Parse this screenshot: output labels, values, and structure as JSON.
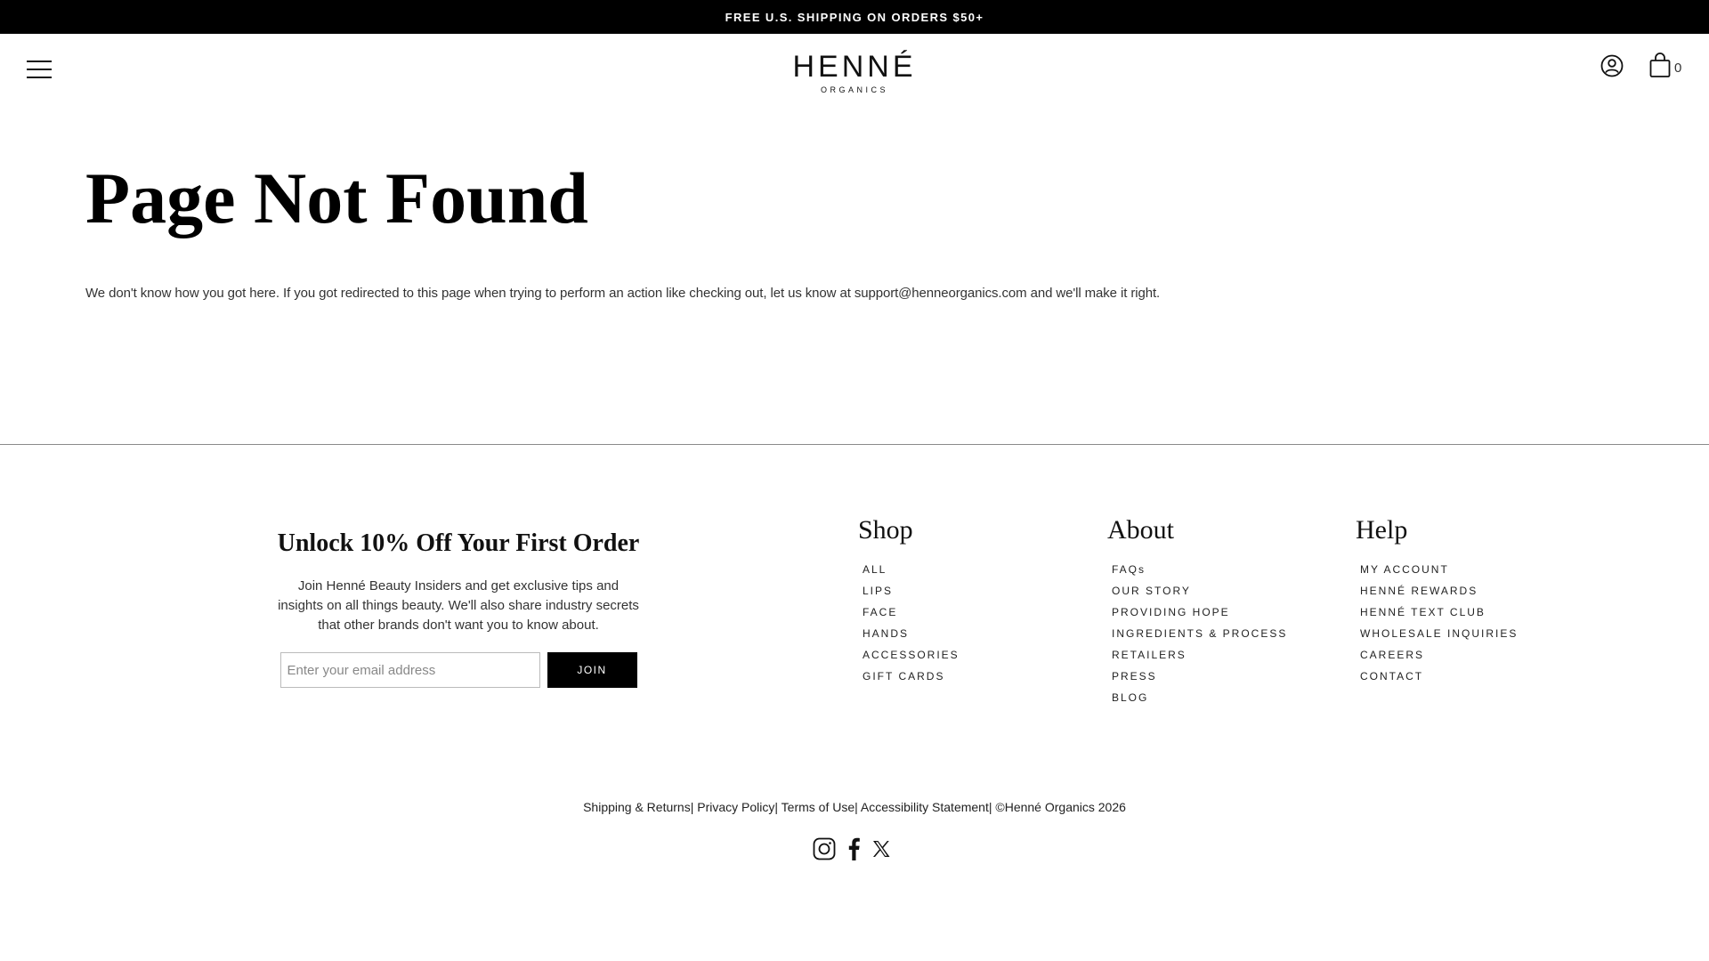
{
  "announcement": "FREE U.S. SHIPPING ON ORDERS $50+",
  "header": {
    "logo_main": "HENNÉ",
    "logo_sub": "ORGANICS",
    "cart_count": "0"
  },
  "main": {
    "title": "Page Not Found",
    "message": "We don't know how you got here. If you got redirected to this page when trying to perform an action like checking out, let us know at support@henneorganics.com and we'll make it right."
  },
  "newsletter": {
    "title": "Unlock 10% Off Your First Order",
    "text": "Join Henné Beauty Insiders and get exclusive tips and insights on all things beauty. We'll also share industry secrets that other brands don't want you to know about.",
    "placeholder": "Enter your email address",
    "button": "JOIN"
  },
  "footer": {
    "shop": {
      "title": "Shop",
      "items": [
        "ALL",
        "LIPS",
        "FACE",
        "HANDS",
        "ACCESSORIES",
        "GIFT CARDS"
      ]
    },
    "about": {
      "title": "About",
      "items": [
        "FAQs",
        "OUR STORY",
        "PROVIDING HOPE",
        "INGREDIENTS & PROCESS",
        "RETAILERS",
        "PRESS",
        "BLOG"
      ]
    },
    "help": {
      "title": "Help",
      "items": [
        "MY ACCOUNT",
        "HENNÉ REWARDS",
        "HENNÉ TEXT CLUB",
        "WHOLESALE INQUIRIES",
        "CAREERS",
        "CONTACT"
      ]
    },
    "legal": {
      "shipping": "Shipping & Returns",
      "privacy": "Privacy Policy",
      "terms": "Terms of Use",
      "accessibility": "Accessibility Statement",
      "copyright": "©Henné Organics 2026",
      "separator": "|"
    }
  },
  "icons": {
    "menu": "hamburger-menu-icon",
    "account": "account-icon",
    "cart": "shopping-bag-icon",
    "instagram": "instagram-icon",
    "facebook": "facebook-icon",
    "x": "x-twitter-icon"
  }
}
